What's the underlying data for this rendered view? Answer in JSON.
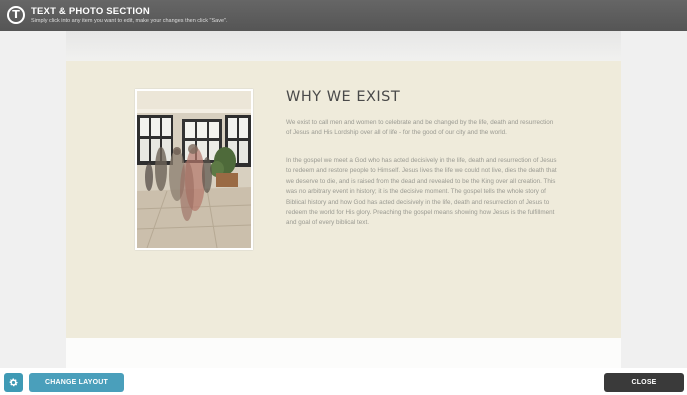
{
  "header": {
    "logo_letter": "T",
    "title": "TEXT & PHOTO SECTION",
    "subtitle": "Simply click into any item you want to edit, make your changes then click \"Save\"."
  },
  "section": {
    "heading": "WHY WE EXIST",
    "paragraphs": [
      "We exist to call men and women to celebrate and be changed by the life, death and resurrection of Jesus and His Lordship over all of life - for the good of our city and the world.",
      "In the gospel we meet a God who has acted decisively in the life, death and resurrection of Jesus to redeem and restore people to Himself. Jesus lives the life we could not live, dies the death that we deserve to die, and is raised from the dead and revealed to be the King over all creation. This was no arbitrary event in history; it is the decisive moment. The gospel tells the whole story of Biblical history and how God has acted decisively in the life, death and resurrection of Jesus to redeem the world for His glory. Preaching the gospel means showing how Jesus is the fulfillment and goal of every biblical text."
    ],
    "background_color": "#efebdb"
  },
  "footer": {
    "settings_icon": "gear-icon",
    "change_layout_label": "CHANGE LAYOUT",
    "close_label": "CLOSE"
  },
  "colors": {
    "topbar": "#5e5e5e",
    "accent": "#4a9fbb",
    "close": "#3a3a3a"
  }
}
